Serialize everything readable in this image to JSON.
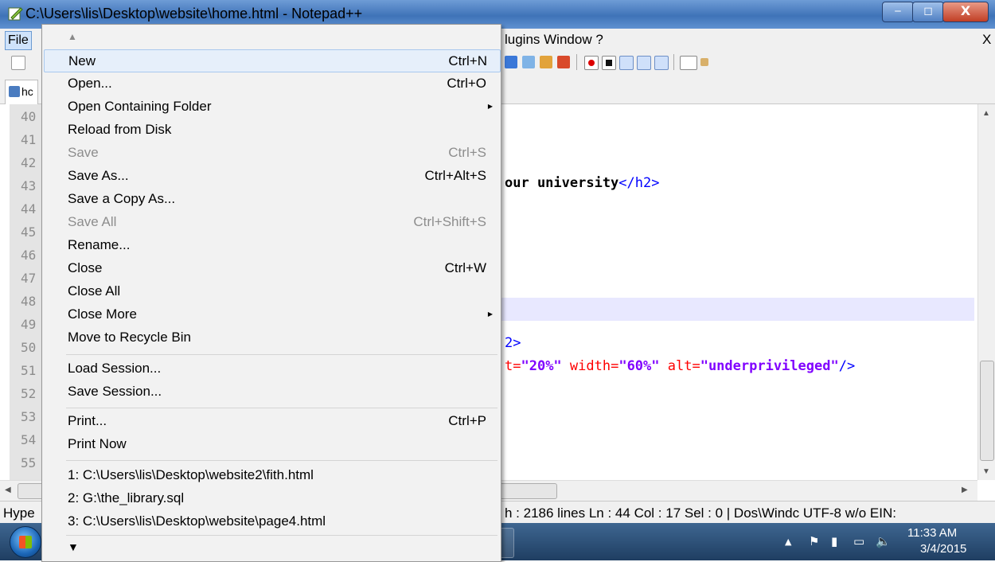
{
  "window": {
    "title": "C:\\Users\\lis\\Desktop\\website\\home.html - Notepad++",
    "minimize": "‒",
    "maximize": "◻",
    "close": "X"
  },
  "menubar": {
    "file": "File",
    "visible_right": "lugins Window ?",
    "close_x": "X"
  },
  "tab": {
    "label": "hc"
  },
  "editor": {
    "line_numbers": [
      "40",
      "41",
      "42",
      "43",
      "44",
      "45",
      "46",
      "47",
      "48",
      "49",
      "50",
      "51",
      "52",
      "53",
      "54",
      "55"
    ],
    "line43": {
      "text": "our university",
      "close_tag": "</h2>"
    },
    "line50": {
      "text": "2>"
    },
    "line51": {
      "a1_tail": "t=",
      "v1": "\"20%\"",
      "a2": " width=",
      "v2": "\"60%\"",
      "a3": " alt=",
      "v3": "\"underprivileged\"",
      "end": "/>"
    }
  },
  "statusbar": {
    "left": "Hype",
    "right": "h : 2186   lines Ln : 44   Col : 17   Sel : 0 | Dos\\Windc UTF-8 w/o EIN:"
  },
  "taskbar": {
    "time": "11:33 AM",
    "date": "3/4/2015"
  },
  "file_menu": {
    "items": [
      {
        "label": "New",
        "shortcut": "Ctrl+N",
        "highlighted": true,
        "disabled": false,
        "submenu": false
      },
      {
        "label": "Open...",
        "shortcut": "Ctrl+O",
        "disabled": false,
        "submenu": false
      },
      {
        "label": "Open Containing Folder",
        "shortcut": "",
        "disabled": false,
        "submenu": true
      },
      {
        "label": "Reload from Disk",
        "shortcut": "",
        "disabled": false,
        "submenu": false
      },
      {
        "label": "Save",
        "shortcut": "Ctrl+S",
        "disabled": true,
        "submenu": false
      },
      {
        "label": "Save As...",
        "shortcut": "Ctrl+Alt+S",
        "disabled": false,
        "submenu": false
      },
      {
        "label": "Save a Copy As...",
        "shortcut": "",
        "disabled": false,
        "submenu": false
      },
      {
        "label": "Save All",
        "shortcut": "Ctrl+Shift+S",
        "disabled": true,
        "submenu": false
      },
      {
        "label": "Rename...",
        "shortcut": "",
        "disabled": false,
        "submenu": false
      },
      {
        "label": "Close",
        "shortcut": "Ctrl+W",
        "disabled": false,
        "submenu": false
      },
      {
        "label": "Close All",
        "shortcut": "",
        "disabled": false,
        "submenu": false
      },
      {
        "label": "Close More",
        "shortcut": "",
        "disabled": false,
        "submenu": true
      },
      {
        "label": "Move to Recycle Bin",
        "shortcut": "",
        "disabled": false,
        "submenu": false
      },
      {
        "label": "Load Session...",
        "shortcut": "",
        "disabled": false,
        "submenu": false
      },
      {
        "label": "Save Session...",
        "shortcut": "",
        "disabled": false,
        "submenu": false
      },
      {
        "label": "Print...",
        "shortcut": "Ctrl+P",
        "disabled": false,
        "submenu": false
      },
      {
        "label": "Print Now",
        "shortcut": "",
        "disabled": false,
        "submenu": false
      },
      {
        "label": "1: C:\\Users\\lis\\Desktop\\website2\\fith.html",
        "shortcut": "",
        "disabled": false,
        "submenu": false
      },
      {
        "label": "2: G:\\the_library.sql",
        "shortcut": "",
        "disabled": false,
        "submenu": false
      },
      {
        "label": "3: C:\\Users\\lis\\Desktop\\website\\page4.html",
        "shortcut": "",
        "disabled": false,
        "submenu": false
      }
    ],
    "icons": {
      "scroll_up": "scroll-up-icon",
      "scroll_down": "scroll-down-icon",
      "submenu": "submenu-arrow-icon"
    }
  },
  "colors": {
    "titlebar": "#3f73b8",
    "tag": "#0000ff",
    "attr": "#ff0000",
    "value": "#8000ff",
    "current_line": "#e8e8ff"
  }
}
